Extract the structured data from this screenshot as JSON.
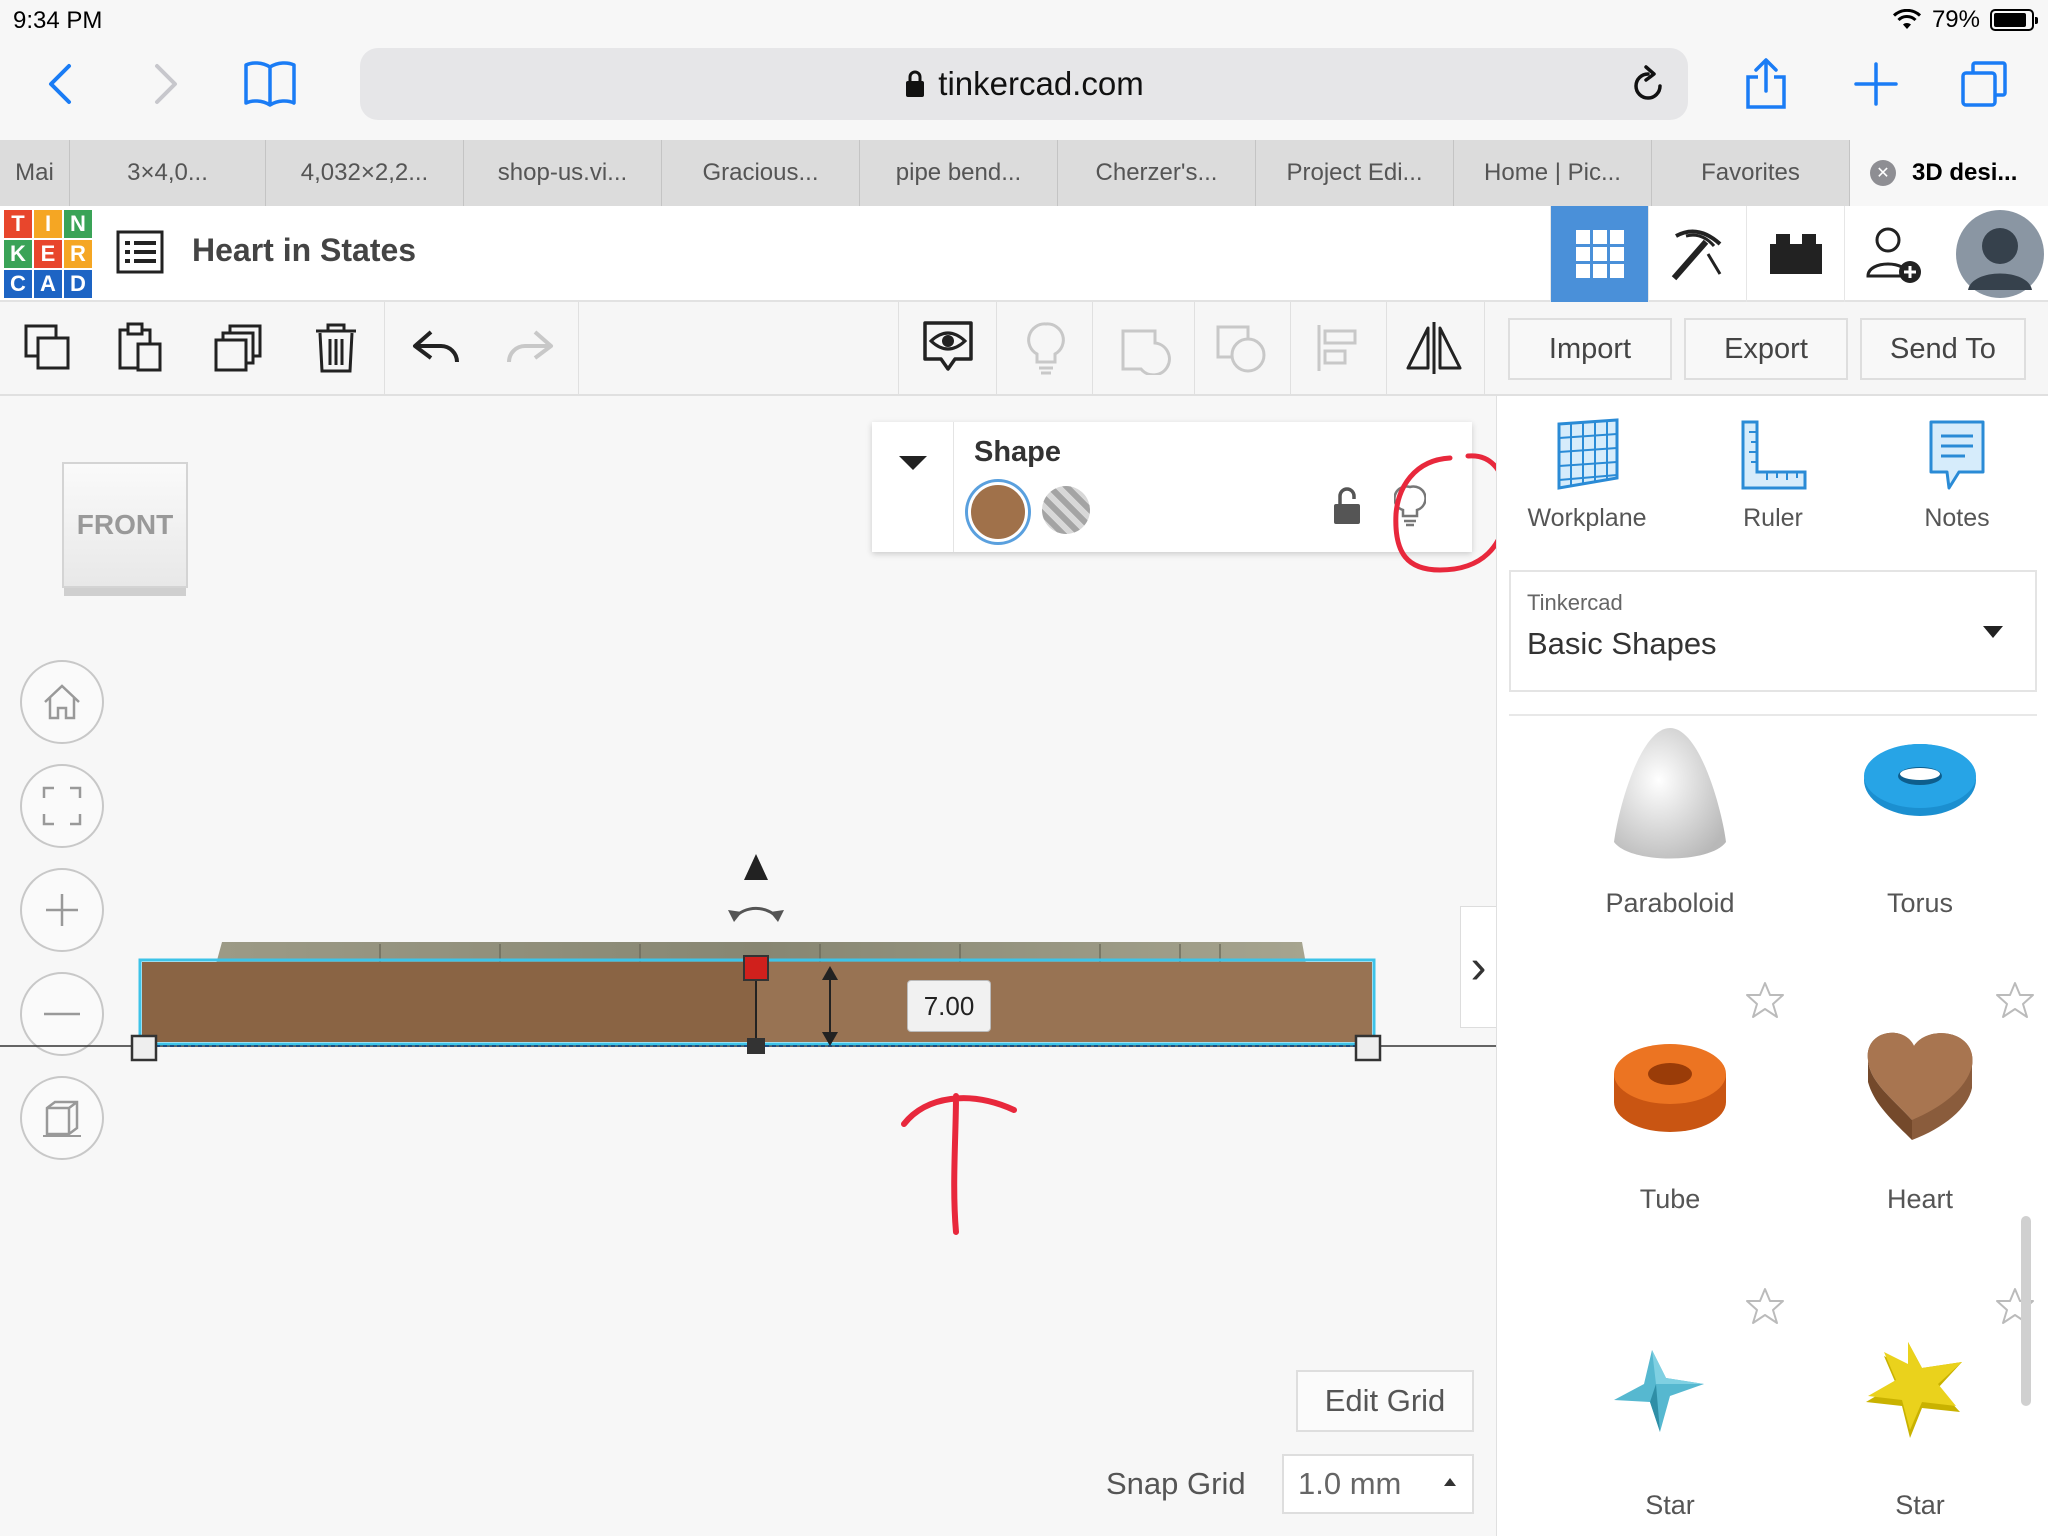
{
  "status_bar": {
    "time": "9:34 PM",
    "battery": "79%",
    "battery_level": 0.79
  },
  "browser": {
    "url": "tinkercad.com",
    "tabs": [
      {
        "label": "Mai"
      },
      {
        "label": "3×4,0..."
      },
      {
        "label": "4,032×2,2..."
      },
      {
        "label": "shop-us.vi..."
      },
      {
        "label": "Gracious..."
      },
      {
        "label": "pipe bend..."
      },
      {
        "label": "Cherzer's..."
      },
      {
        "label": "Project Edi..."
      },
      {
        "label": "Home | Pic..."
      },
      {
        "label": "Favorites"
      },
      {
        "label": "3D desi..."
      }
    ]
  },
  "app": {
    "logo_letters": [
      "T",
      "I",
      "N",
      "K",
      "E",
      "R",
      "C",
      "A",
      "D"
    ],
    "logo_colors": [
      "#e8462c",
      "#f5a623",
      "#3aa357",
      "#3aa357",
      "#e8462c",
      "#f5a623",
      "#1d64c4",
      "#1d64c4",
      "#1d64c4"
    ],
    "design_title": "Heart in States",
    "accent_color": "#4a90d9"
  },
  "toolbar": {
    "import_label": "Import",
    "export_label": "Export",
    "send_to_label": "Send To"
  },
  "workplane": {
    "view_cube_label": "FRONT",
    "inspector_title": "Shape",
    "shape_color": "#a0714a",
    "dimension_value": "7.00",
    "edit_grid_label": "Edit Grid",
    "snap_grid_label": "Snap Grid",
    "snap_grid_value": "1.0 mm"
  },
  "panel": {
    "workplane_label": "Workplane",
    "ruler_label": "Ruler",
    "notes_label": "Notes",
    "provider": "Tinkercad",
    "category": "Basic Shapes",
    "shapes": [
      {
        "name": "Paraboloid"
      },
      {
        "name": "Torus"
      },
      {
        "name": "Tube"
      },
      {
        "name": "Heart"
      },
      {
        "name": "Star"
      },
      {
        "name": "Star"
      }
    ]
  }
}
